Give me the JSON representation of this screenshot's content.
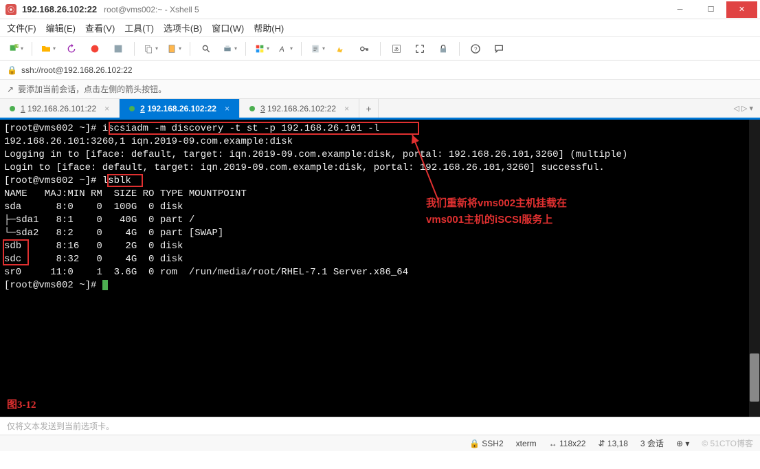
{
  "titlebar": {
    "app_icon_glyph": "⦿",
    "title": "192.168.26.102:22",
    "subtitle": "root@vms002:~ - Xshell 5"
  },
  "menubar": {
    "items": [
      "文件(F)",
      "编辑(E)",
      "查看(V)",
      "工具(T)",
      "选项卡(B)",
      "窗口(W)",
      "帮助(H)"
    ]
  },
  "address": {
    "lock_glyph": "🔒",
    "url": "ssh://root@192.168.26.102:22"
  },
  "infobar": {
    "icon_glyph": "↗",
    "text": "要添加当前会话，点击左侧的箭头按钮。"
  },
  "tabs": {
    "items": [
      {
        "num": "1",
        "label": "192.168.26.101:22",
        "active": false
      },
      {
        "num": "2",
        "label": "192.168.26.102:22",
        "active": true
      },
      {
        "num": "3",
        "label": "192.168.26.102:22",
        "active": false
      }
    ],
    "nav_glyph": "◁ ▷ ▾"
  },
  "terminal": {
    "lines": [
      "[root@vms002 ~]# iscsiadm -m discovery -t st -p 192.168.26.101 -l",
      "192.168.26.101:3260,1 iqn.2019-09.com.example:disk",
      "Logging in to [iface: default, target: iqn.2019-09.com.example:disk, portal: 192.168.26.101,3260] (multiple)",
      "Login to [iface: default, target: iqn.2019-09.com.example:disk, portal: 192.168.26.101,3260] successful.",
      "[root@vms002 ~]# lsblk",
      "NAME   MAJ:MIN RM  SIZE RO TYPE MOUNTPOINT",
      "sda      8:0    0  100G  0 disk ",
      "├─sda1   8:1    0   40G  0 part /",
      "└─sda2   8:2    0    4G  0 part [SWAP]",
      "sdb      8:16   0    2G  0 disk ",
      "sdc      8:32   0    4G  0 disk ",
      "sr0     11:0    1  3.6G  0 rom  /run/media/root/RHEL-7.1 Server.x86_64",
      "[root@vms002 ~]# "
    ],
    "annotation_line1": "我们重新将vms002主机挂载在",
    "annotation_line2": "vms001主机的iSCSI服务上",
    "figure_label": "图3-12"
  },
  "compose": {
    "placeholder": "仅将文本发送到当前选项卡。"
  },
  "statusbar": {
    "ssh": "SSH2",
    "term": "xterm",
    "size": "118x22",
    "cursor_icon": "⇵",
    "size_icon": "↔",
    "pos": "13,18",
    "sessions": "3 会话",
    "cap_icon": "⎁",
    "sess_icon": "↕",
    "plus_glyph": "⊕ ▾",
    "watermark": "© 51CTO博客"
  }
}
